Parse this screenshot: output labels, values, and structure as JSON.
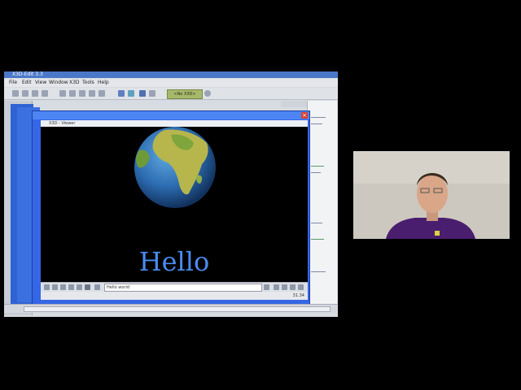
{
  "app": {
    "title": "X3D-Edit 3.3"
  },
  "menubar": {
    "items": [
      "File",
      "Edit",
      "View",
      "Window",
      "X3D",
      "Tools",
      "Help"
    ]
  },
  "toolbar": {
    "context_value": "<No X3D>"
  },
  "viewer": {
    "window_title": "X3D - Viewer",
    "close_glyph": "×",
    "scene_text": "Hello",
    "viewpoint": "Hello world",
    "status": "31.34"
  },
  "colors": {
    "hello_text": "#4a8cf0",
    "desktop_bg": "#000000",
    "window_blue": "#3566e6"
  }
}
